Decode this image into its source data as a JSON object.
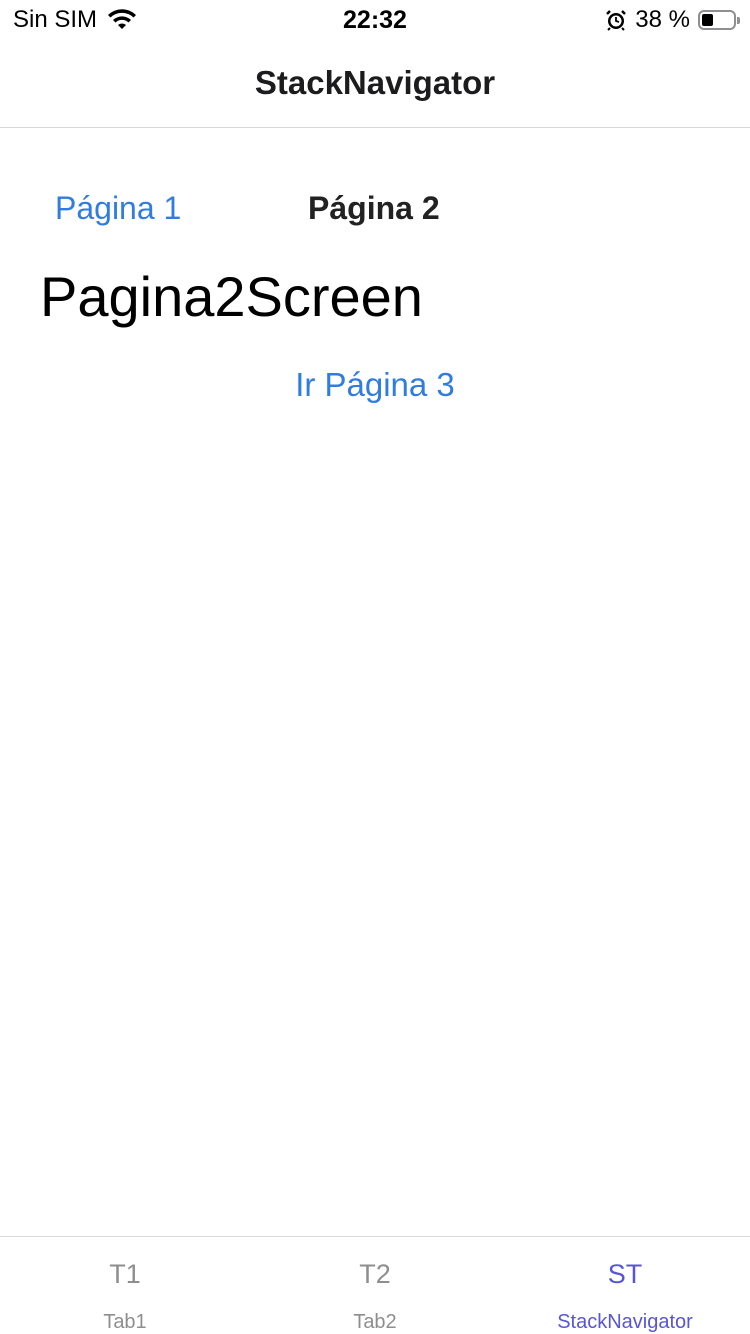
{
  "status_bar": {
    "carrier": "Sin SIM",
    "time": "22:32",
    "battery_percent": "38 %",
    "battery_level": 0.38,
    "icons": [
      "wifi-icon",
      "alarm-icon",
      "battery-icon"
    ]
  },
  "header": {
    "title": "StackNavigator"
  },
  "content": {
    "link_pagina1": "Página 1",
    "link_pagina2": "Página 2",
    "heading": "Pagina2Screen",
    "button_ir_pagina3": "Ir Página 3"
  },
  "colors": {
    "link": "#2f7de1",
    "tab_active": "#5856d6",
    "tab_inactive": "#8e8e8e"
  },
  "tab_bar": {
    "tabs": [
      {
        "icon": "T1",
        "label": "Tab1",
        "active": false
      },
      {
        "icon": "T2",
        "label": "Tab2",
        "active": false
      },
      {
        "icon": "ST",
        "label": "StackNavigator",
        "active": true
      }
    ]
  }
}
